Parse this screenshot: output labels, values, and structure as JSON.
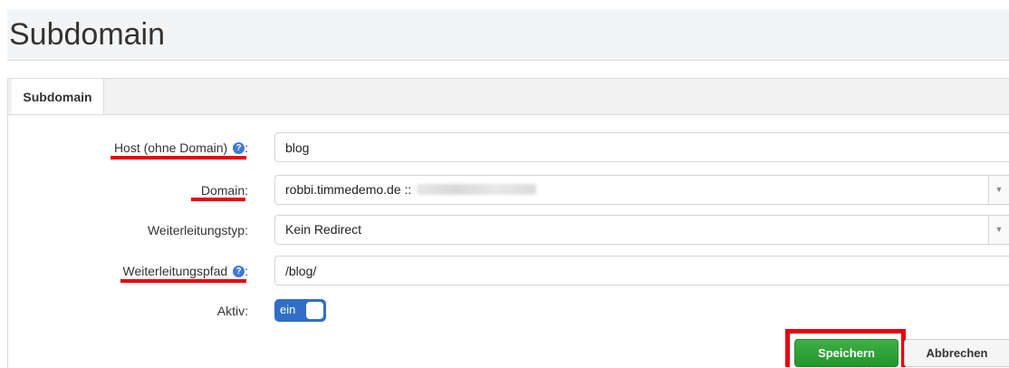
{
  "page": {
    "title": "Subdomain"
  },
  "tabs": [
    {
      "label": "Subdomain",
      "active": true
    }
  ],
  "form": {
    "host": {
      "label": "Host (ohne Domain)",
      "suffix": ":",
      "value": "blog",
      "help_icon": "question-circle-icon"
    },
    "domain": {
      "label": "Domain",
      "suffix": ":",
      "value": "robbi.timmedemo.de ::",
      "redacted": true
    },
    "redirect_type": {
      "label": "Weiterleitungstyp",
      "suffix": ":",
      "value": "Kein Redirect"
    },
    "redirect_path": {
      "label": "Weiterleitungspfad",
      "suffix": ":",
      "value": "/blog/",
      "help_icon": "question-circle-icon"
    },
    "active": {
      "label": "Aktiv",
      "suffix": ":",
      "toggle_text": "ein",
      "on": true
    }
  },
  "buttons": {
    "save": "Speichern",
    "cancel": "Abbrechen"
  },
  "colors": {
    "accent": "#2f6fc8",
    "save": "#22962c",
    "highlight": "#e8000b",
    "help": "#3e7bd1"
  }
}
